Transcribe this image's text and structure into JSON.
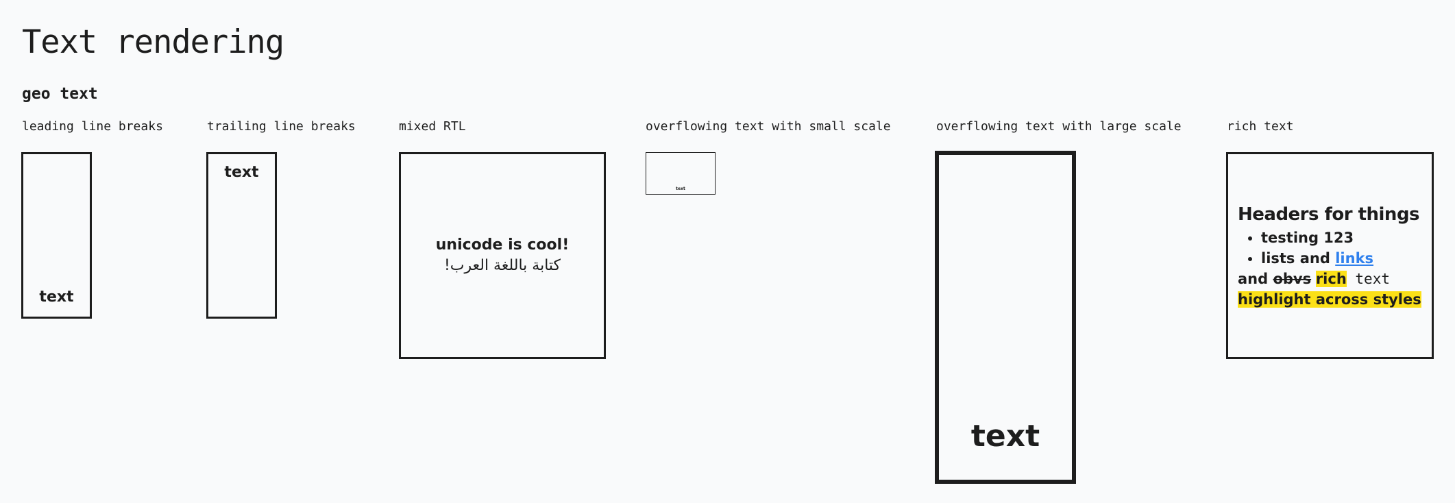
{
  "page": {
    "title": "Text rendering",
    "section": "geo text"
  },
  "examples": [
    {
      "label": "leading line breaks",
      "text": "text"
    },
    {
      "label": "trailing line breaks",
      "text": "text"
    },
    {
      "label": "mixed RTL",
      "line1": "unicode is cool!",
      "line2": "كتابة باللغة  العرب!"
    },
    {
      "label": "overflowing text with small scale",
      "text": "text"
    },
    {
      "label": "overflowing text with large scale",
      "text": "text"
    },
    {
      "label": "rich text",
      "header": "Headers for things",
      "bullets": [
        "testing 123",
        "lists and "
      ],
      "link": "links",
      "line_and": "and ",
      "line_strike": "obvs",
      "line_rich": "rich",
      "line_text": " text",
      "highlight": "highlight across styles"
    }
  ],
  "colors": {
    "background": "#f9fafb",
    "ink": "#1d1d1d",
    "link": "#2f80ed",
    "highlight": "#fbe017"
  }
}
